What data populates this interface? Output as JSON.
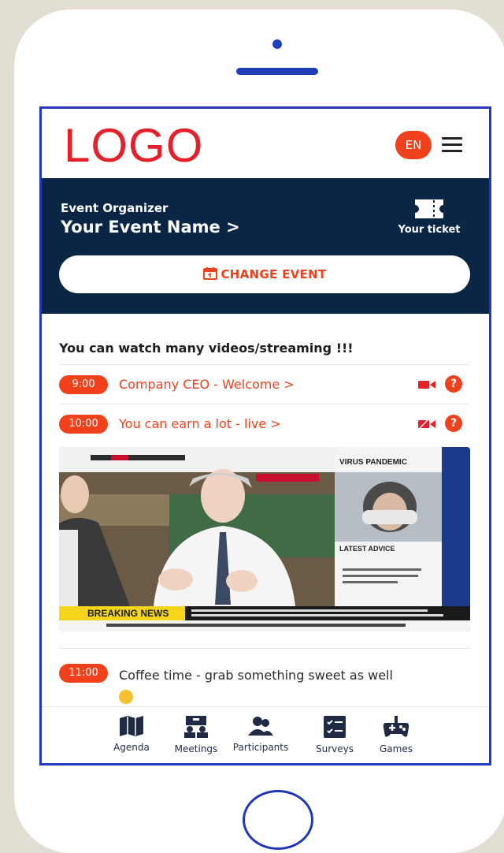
{
  "header": {
    "logo": "LOGO",
    "language": "EN"
  },
  "event": {
    "organizer": "Event Organizer",
    "name": "Your Event Name >",
    "ticket_label": "Your ticket",
    "change_button": "CHANGE EVENT"
  },
  "content": {
    "section_title": "You can watch many videos/streaming !!!",
    "items": [
      {
        "time": "9:00",
        "title": "Company CEO - Welcome >"
      },
      {
        "time": "10:00",
        "title": "You can earn a lot - live >"
      },
      {
        "time": "11:00",
        "title": "Coffee time - grab something sweet as well"
      }
    ]
  },
  "video": {
    "breaking": "BREAKING NEWS",
    "side_title": "VIRUS PANDEMIC",
    "side_advice": "LATEST ADVICE"
  },
  "nav": [
    {
      "label": "Agenda",
      "icon": "book-map-icon"
    },
    {
      "label": "Meetings",
      "icon": "meeting-table-icon"
    },
    {
      "label": "Participants",
      "icon": "people-icon"
    },
    {
      "label": "Surveys",
      "icon": "checklist-icon"
    },
    {
      "label": "Games",
      "icon": "gamepad-icon"
    }
  ],
  "colors": {
    "accent": "#f0401c",
    "header_bg": "#0b2645",
    "logo": "#e4212b",
    "frame": "#2437c0"
  }
}
